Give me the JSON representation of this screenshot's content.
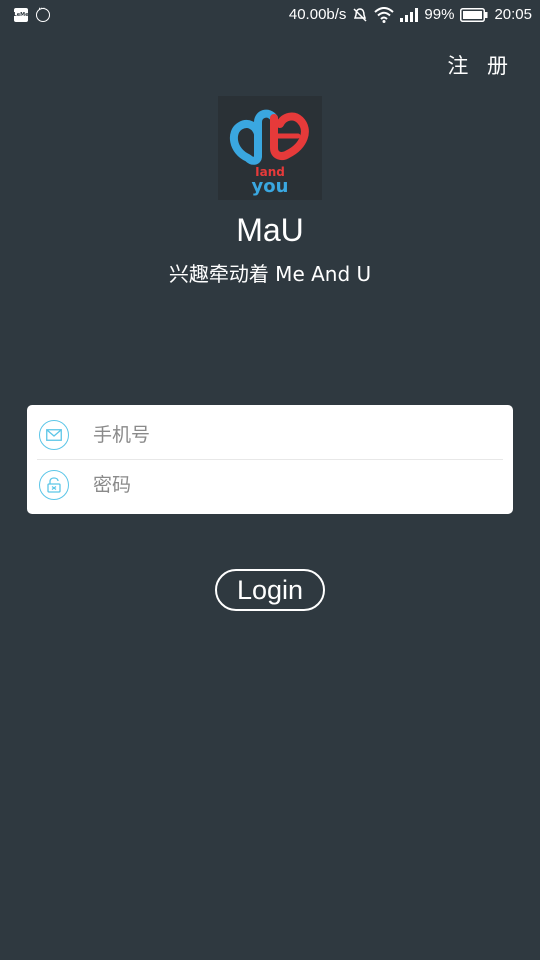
{
  "status_bar": {
    "network_speed": "40.00b/s",
    "battery": "99%",
    "time": "20:05",
    "left_icons": [
      "letv-icon",
      "message-icon"
    ],
    "right_icons": [
      "mute-icon",
      "wifi-icon",
      "signal-icon",
      "battery-icon"
    ]
  },
  "header": {
    "register_label": "注 册"
  },
  "branding": {
    "app_name": "MaU",
    "slogan": "兴趣牵动着 Me And U",
    "logo_text_top": "Iand",
    "logo_text_bottom": "you"
  },
  "form": {
    "phone": {
      "placeholder": "手机号",
      "value": "",
      "icon": "mail-icon"
    },
    "password": {
      "placeholder": "密码",
      "value": "",
      "icon": "lock-icon"
    }
  },
  "login_label": "Login",
  "colors": {
    "background": "#2f3940",
    "card": "#ffffff",
    "icon_accent": "#5cc6e8",
    "logo_blue": "#3aa7e0",
    "logo_red": "#e63a3a"
  }
}
